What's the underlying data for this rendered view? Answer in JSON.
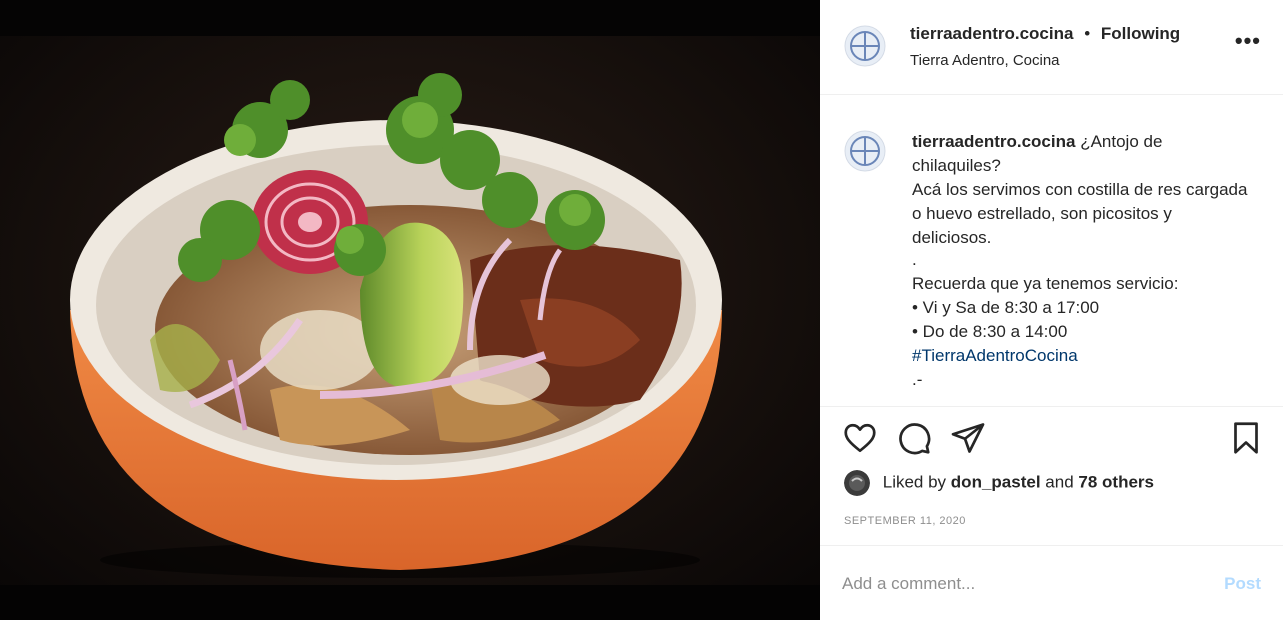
{
  "post": {
    "image_alt": "Bowl of chilaquiles with beef rib, avocado, cilantro, onion and beet slices in an orange clay bowl",
    "header": {
      "username": "tierraadentro.cocina",
      "separator": "•",
      "follow_label": "Following",
      "location": "Tierra Adentro, Cocina",
      "more_label": "•••"
    },
    "caption": {
      "username": "tierraadentro.cocina",
      "line1": "¿Antojo de chilaquiles?",
      "line2": "Acá los servimos con costilla de res cargada o huevo estrellado, son picositos y deliciosos.",
      "line3": ".",
      "line4": "Recuerda que ya tenemos servicio:",
      "line5": "• Vi y Sa de 8:30 a 17:00",
      "line6": "• Do de 8:30 a 14:00",
      "hashtag": "#TierraAdentroCocina",
      "line7": ".-"
    },
    "actions": {
      "like_icon": "heart-icon",
      "comment_icon": "comment-icon",
      "share_icon": "share-icon",
      "save_icon": "bookmark-icon"
    },
    "likes": {
      "prefix": "Liked by",
      "user": "don_pastel",
      "and": "and",
      "others": "78 others"
    },
    "date": "SEPTEMBER 11, 2020",
    "comment": {
      "placeholder": "Add a comment...",
      "post_label": "Post"
    }
  },
  "colors": {
    "link": "#00376b",
    "post_disabled": "#b3dbff",
    "muted": "#8e8e8e",
    "bowl_orange": "#e5793a"
  }
}
